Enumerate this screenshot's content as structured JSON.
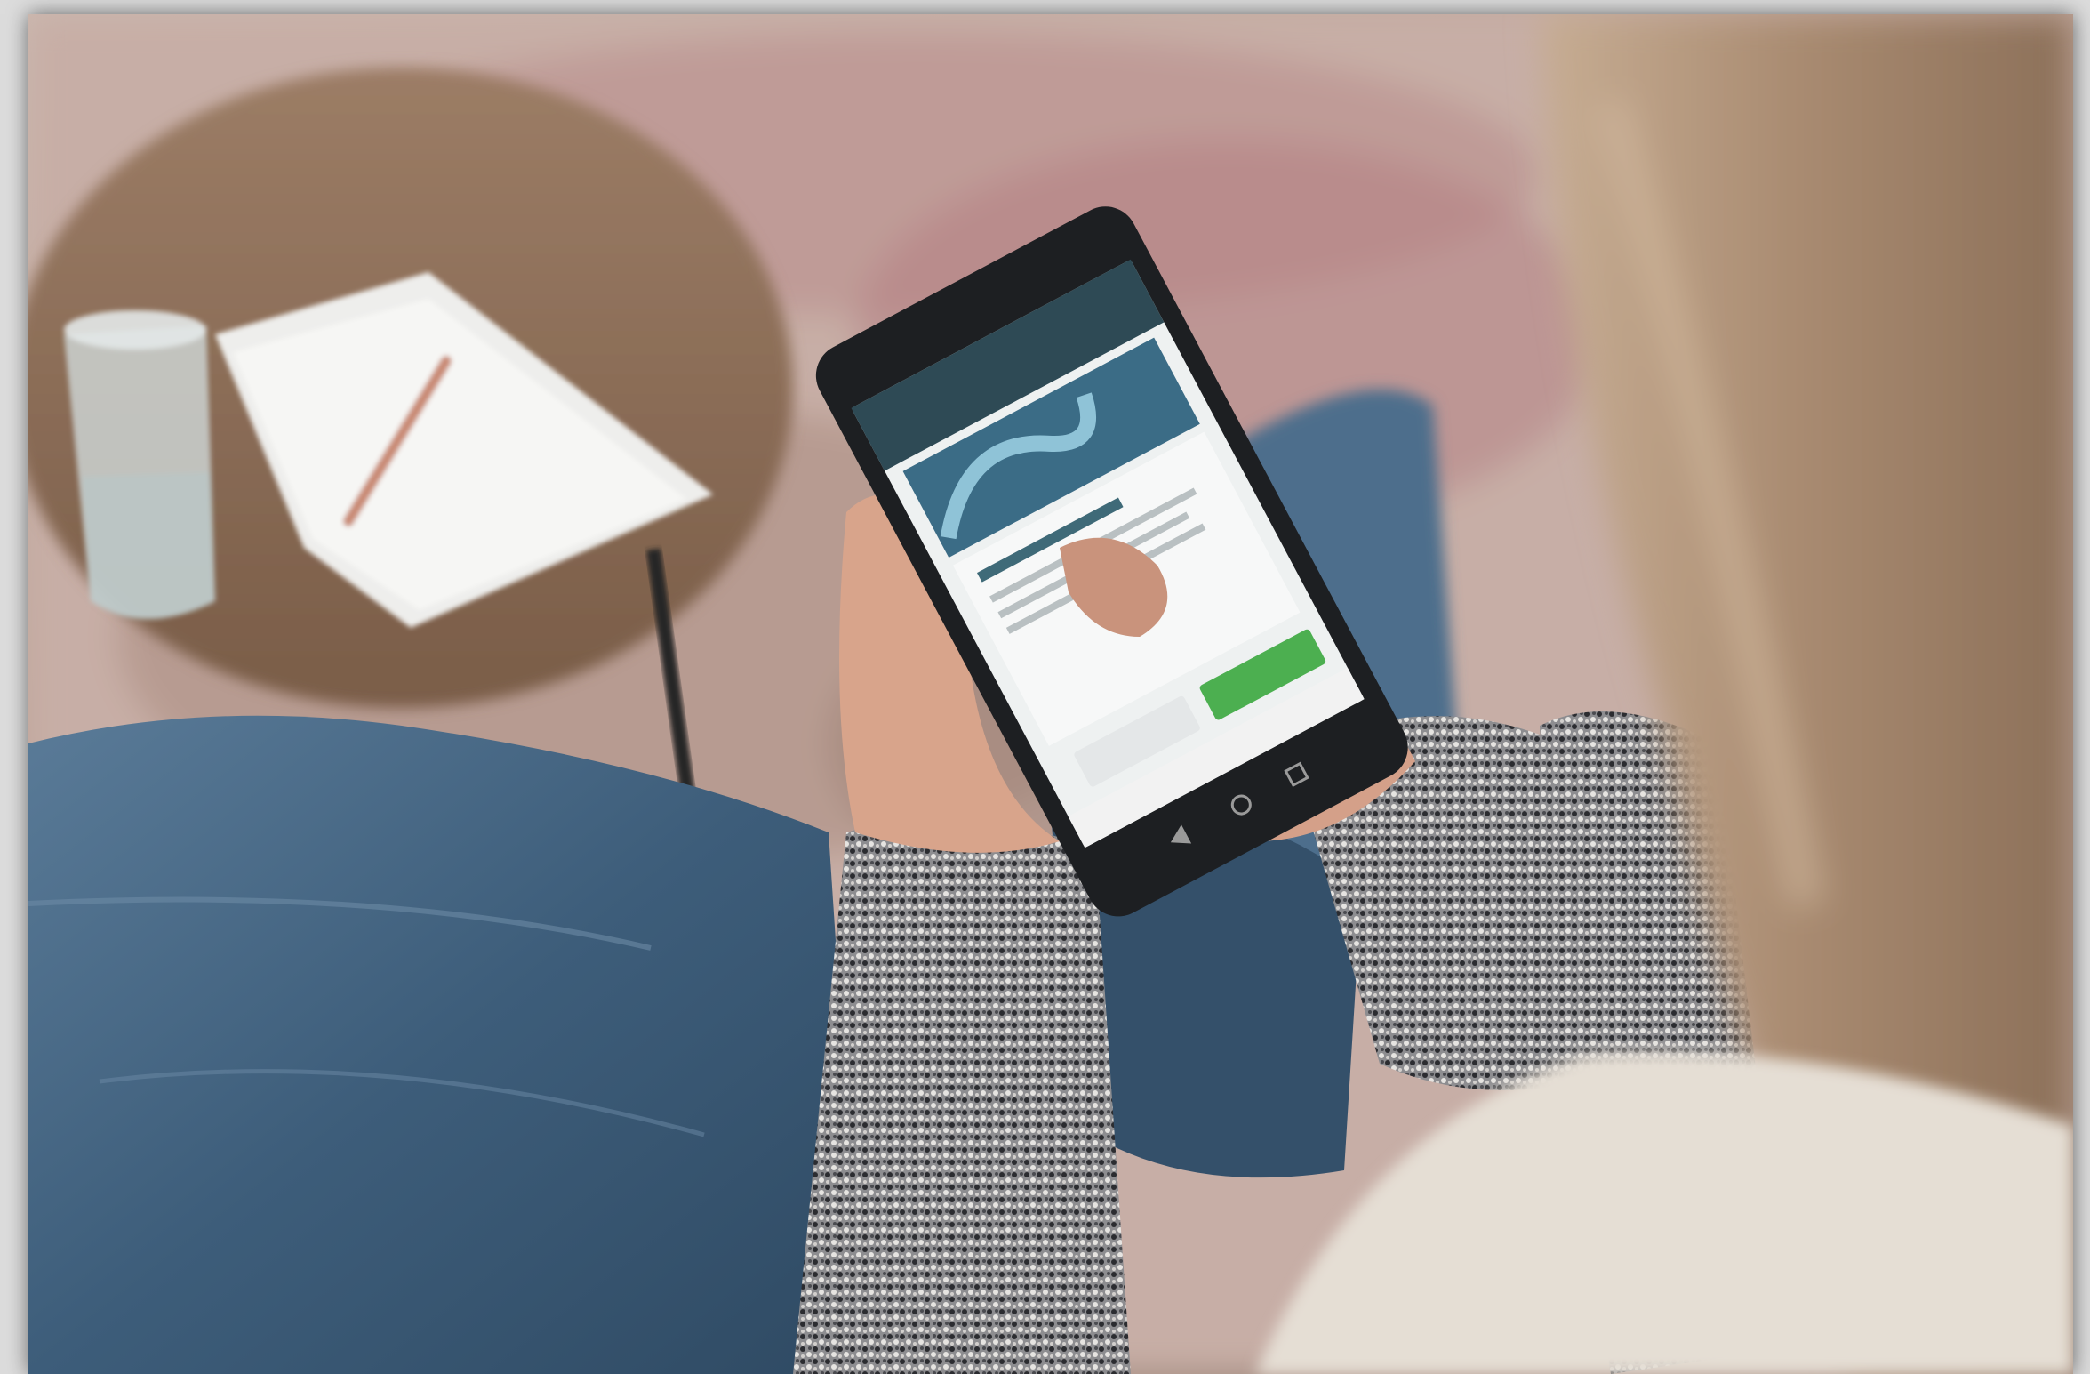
{
  "scene": {
    "description_free": true,
    "colors": {
      "rug": "#c9a7a0",
      "rug_pattern": "#b78588",
      "table_wood": "#8a6c55",
      "table_leg": "#2a2a2a",
      "paper": "#eeeeec",
      "pencil": "#c98a75",
      "glass": "#cfd8d8",
      "jeans": "#3d5d7a",
      "jeans_light": "#5f7f9c",
      "sweater_dark": "#3a3c40",
      "sweater_light": "#c9c7c4",
      "skin": "#d8a48b",
      "hair": "#b99c80",
      "phone_body": "#1d1f22",
      "screen_header": "#2e4a55",
      "screen_card": "#eef1f1",
      "screen_button_accent": "#4caf50"
    }
  },
  "phone_screen": {
    "header_text": "",
    "card_title": "",
    "decline_label": "",
    "accept_label": ""
  }
}
